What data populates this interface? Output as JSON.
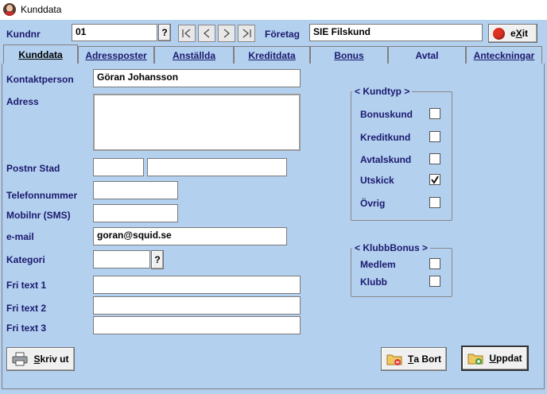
{
  "window": {
    "title": "Kunddata"
  },
  "header": {
    "kundnr_label": "Kundnr",
    "kundnr_value": "01",
    "lookup_label": "?",
    "foretag_label": "Företag",
    "foretag_value": "SIE Filskund",
    "exit_label_pre": "e",
    "exit_label_u": "X",
    "exit_label_post": "it"
  },
  "tabs": [
    {
      "label": "Kunddata",
      "active": true
    },
    {
      "label": "Adressposter"
    },
    {
      "label": "Anställda"
    },
    {
      "label": "Kreditdata"
    },
    {
      "label": "Bonus"
    },
    {
      "label": "Avtal"
    },
    {
      "label": "Anteckningar"
    }
  ],
  "form": {
    "kontaktperson_label": "Kontaktperson",
    "kontaktperson_value": "Göran Johansson",
    "adress_label": "Adress",
    "adress_value": "",
    "postnr_label": "Postnr Stad",
    "postnr_value": "",
    "stad_value": "",
    "telefon_label": "Telefonnummer",
    "telefon_value": "",
    "mobil_label": "Mobilnr (SMS)",
    "mobil_value": "",
    "email_label": "e-mail",
    "email_value": "goran@squid.se",
    "kategori_label": "Kategori",
    "kategori_value": "",
    "kategori_lookup": "?",
    "fritext1_label": "Fri text 1",
    "fritext1_value": "",
    "fritext2_label": "Fri text 2",
    "fritext2_value": "",
    "fritext3_label": "Fri text 3",
    "fritext3_value": ""
  },
  "kundtyp": {
    "title": "< Kundtyp >",
    "items": [
      {
        "label": "Bonuskund",
        "checked": false
      },
      {
        "label": "Kreditkund",
        "checked": false
      },
      {
        "label": "Avtalskund",
        "checked": false
      },
      {
        "label": "Utskick",
        "checked": true
      },
      {
        "label": "Övrig",
        "checked": false
      }
    ]
  },
  "klubbbonus": {
    "title": "< KlubbBonus >",
    "items": [
      {
        "label": "Medlem",
        "checked": false
      },
      {
        "label": "Klubb",
        "checked": false
      }
    ]
  },
  "buttons": {
    "print_u": "S",
    "print_rest": "kriv ut",
    "delete_u": "T",
    "delete_rest": "a Bort",
    "update_u": "U",
    "update_rest": "ppdat"
  },
  "colors": {
    "background": "#b4d0ef",
    "label": "#1a1a6e",
    "exit_icon": "#e03020"
  }
}
